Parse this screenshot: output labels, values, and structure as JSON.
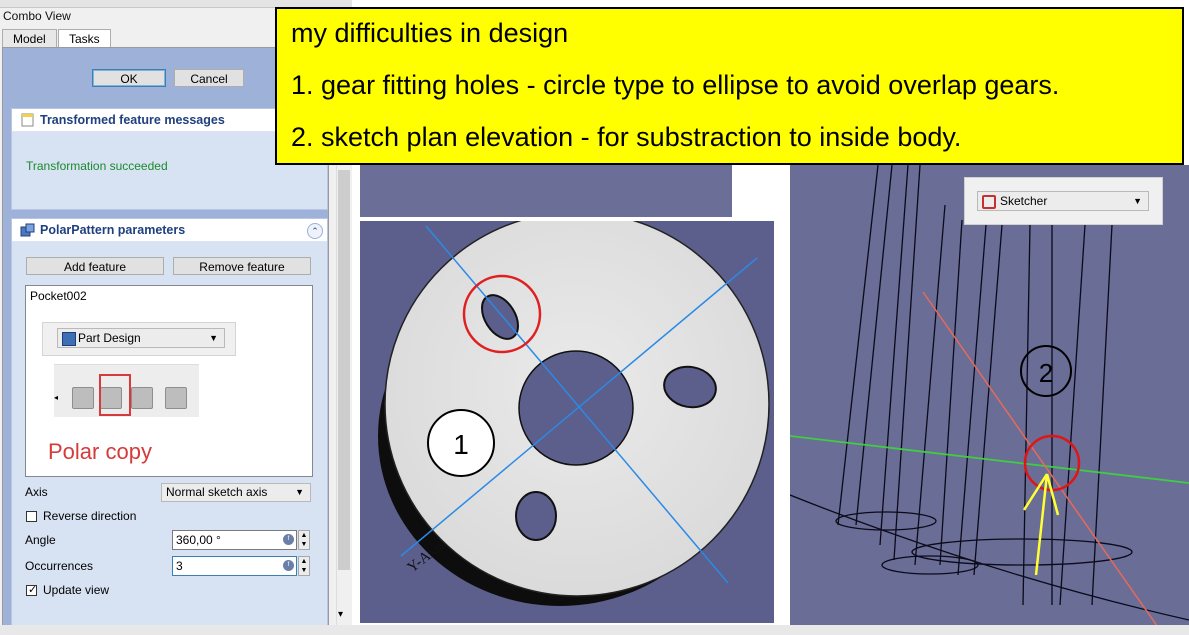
{
  "combo_view": {
    "title": "Combo View",
    "tabs": [
      {
        "label": "Model",
        "active": false
      },
      {
        "label": "Tasks",
        "active": true
      }
    ],
    "ok_label": "OK",
    "cancel_label": "Cancel"
  },
  "messages_panel": {
    "title": "Transformed feature messages",
    "message": "Transformation succeeded",
    "message_color": "#1b8a2c"
  },
  "polar_panel": {
    "title": "PolarPattern parameters",
    "add_feature_label": "Add feature",
    "remove_feature_label": "Remove feature",
    "features": [
      "Pocket002"
    ],
    "workbench_label": "Part Design",
    "polar_copy_label": "Polar copy",
    "axis_label": "Axis",
    "axis_value": "Normal sketch axis",
    "reverse_label": "Reverse direction",
    "reverse_checked": false,
    "angle_label": "Angle",
    "angle_value": "360,00 °",
    "occurrences_label": "Occurrences",
    "occurrences_value": "3",
    "update_label": "Update view",
    "update_checked": true
  },
  "view_left": {
    "marker_label": "1",
    "axis_text": "Y-Axis"
  },
  "view_right": {
    "workbench_label": "Sketcher",
    "marker_label": "2"
  },
  "annotation": {
    "title": "my difficulties in design",
    "line1": "1. gear fitting holes - circle type to ellipse to avoid overlap gears.",
    "line2": "2. sketch plan elevation - for substraction to inside body."
  },
  "colors": {
    "highlight_red": "#d63a3a",
    "note_yellow": "#ffff00",
    "viewport_bg": "#5c5e8c",
    "axis_blue": "#2b8ae6",
    "axis_green": "#3fce3f",
    "arrow_yellow": "#ffff33"
  }
}
